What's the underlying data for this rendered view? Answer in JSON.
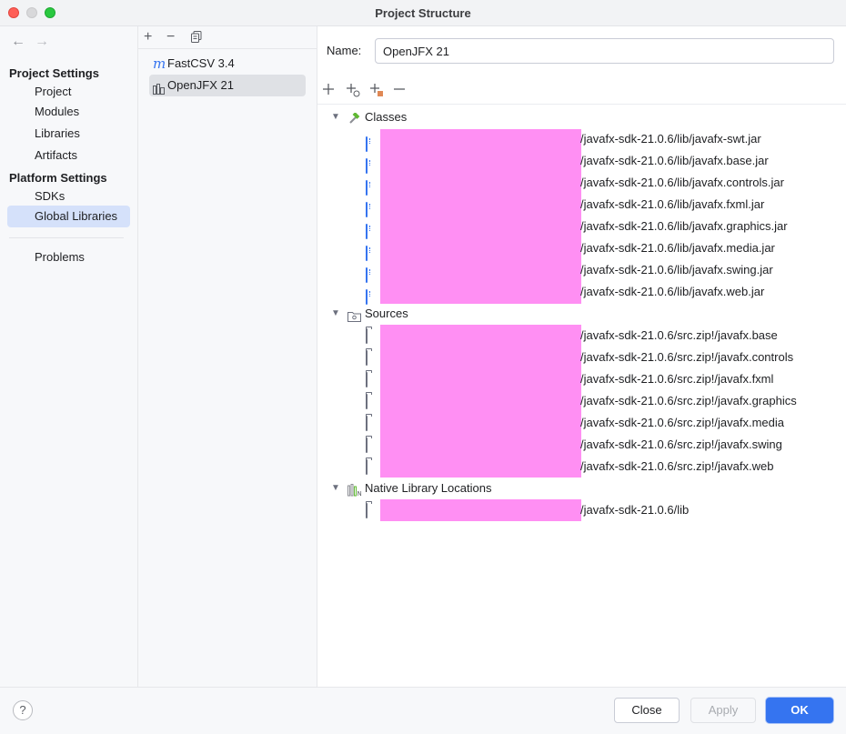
{
  "window": {
    "title": "Project Structure"
  },
  "nav": {
    "back_icon": "arrow-left-icon",
    "forward_icon": "arrow-right-icon",
    "project_settings_header": "Project Settings",
    "project_settings": [
      "Project",
      "Modules",
      "Libraries",
      "Artifacts"
    ],
    "platform_settings_header": "Platform Settings",
    "platform_settings": [
      "SDKs",
      "Global Libraries"
    ],
    "problems": "Problems",
    "selected": "Global Libraries"
  },
  "libraries": {
    "toolbar": {
      "add": "+",
      "remove": "−",
      "copy": "copy-icon"
    },
    "items": [
      {
        "name": "FastCSV 3.4",
        "icon": "maven-icon"
      },
      {
        "name": "OpenJFX 21",
        "icon": "library-icon"
      }
    ],
    "selected": "OpenJFX 21"
  },
  "detail": {
    "name_label": "Name:",
    "name_value": "OpenJFX 21",
    "toolbar": [
      "add-icon",
      "add-config-icon",
      "add-native-icon",
      "remove-icon"
    ],
    "classes": {
      "label": "Classes",
      "items": [
        "/javafx-sdk-21.0.6/lib/javafx-swt.jar",
        "/javafx-sdk-21.0.6/lib/javafx.base.jar",
        "/javafx-sdk-21.0.6/lib/javafx.controls.jar",
        "/javafx-sdk-21.0.6/lib/javafx.fxml.jar",
        "/javafx-sdk-21.0.6/lib/javafx.graphics.jar",
        "/javafx-sdk-21.0.6/lib/javafx.media.jar",
        "/javafx-sdk-21.0.6/lib/javafx.swing.jar",
        "/javafx-sdk-21.0.6/lib/javafx.web.jar"
      ]
    },
    "sources": {
      "label": "Sources",
      "items": [
        "/javafx-sdk-21.0.6/src.zip!/javafx.base",
        "/javafx-sdk-21.0.6/src.zip!/javafx.controls",
        "/javafx-sdk-21.0.6/src.zip!/javafx.fxml",
        "/javafx-sdk-21.0.6/src.zip!/javafx.graphics",
        "/javafx-sdk-21.0.6/src.zip!/javafx.media",
        "/javafx-sdk-21.0.6/src.zip!/javafx.swing",
        "/javafx-sdk-21.0.6/src.zip!/javafx.web"
      ]
    },
    "native": {
      "label": "Native Library Locations",
      "items": [
        "/javafx-sdk-21.0.6/lib"
      ]
    },
    "redaction_color": "#ff8ff3"
  },
  "footer": {
    "help": "?",
    "close": "Close",
    "apply": "Apply",
    "ok": "OK"
  }
}
